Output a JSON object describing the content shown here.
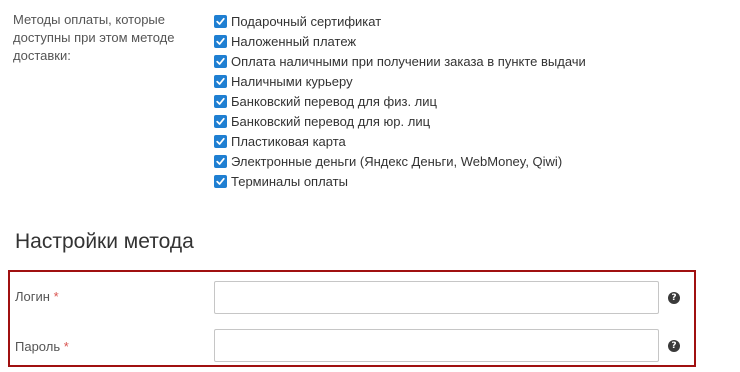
{
  "payment_methods": {
    "label": "Методы оплаты, которые доступны при этом методе доставки:",
    "items": [
      {
        "label": "Подарочный сертификат",
        "checked": true
      },
      {
        "label": "Наложенный платеж",
        "checked": true
      },
      {
        "label": "Оплата наличными при получении заказа в пункте выдачи",
        "checked": true
      },
      {
        "label": "Наличными курьеру",
        "checked": true
      },
      {
        "label": "Банковский перевод для физ. лиц",
        "checked": true
      },
      {
        "label": "Банковский перевод для юр. лиц",
        "checked": true
      },
      {
        "label": "Пластиковая карта",
        "checked": true
      },
      {
        "label": "Электронные деньги (Яндекс Деньги, WebMoney, Qiwi)",
        "checked": true
      },
      {
        "label": "Терминалы оплаты",
        "checked": true
      }
    ]
  },
  "method_settings": {
    "title": "Настройки метода",
    "required_mark": "*",
    "login": {
      "label": "Логин",
      "value": "",
      "placeholder": ""
    },
    "password": {
      "label": "Пароль",
      "value": "",
      "placeholder": ""
    },
    "help_glyph": "?"
  },
  "colors": {
    "checkbox": "#1f7fd2",
    "required": "#d9534f",
    "highlight_border": "#a01010"
  },
  "icons": {
    "checkbox": "check-icon",
    "help": "question-circle-icon"
  }
}
